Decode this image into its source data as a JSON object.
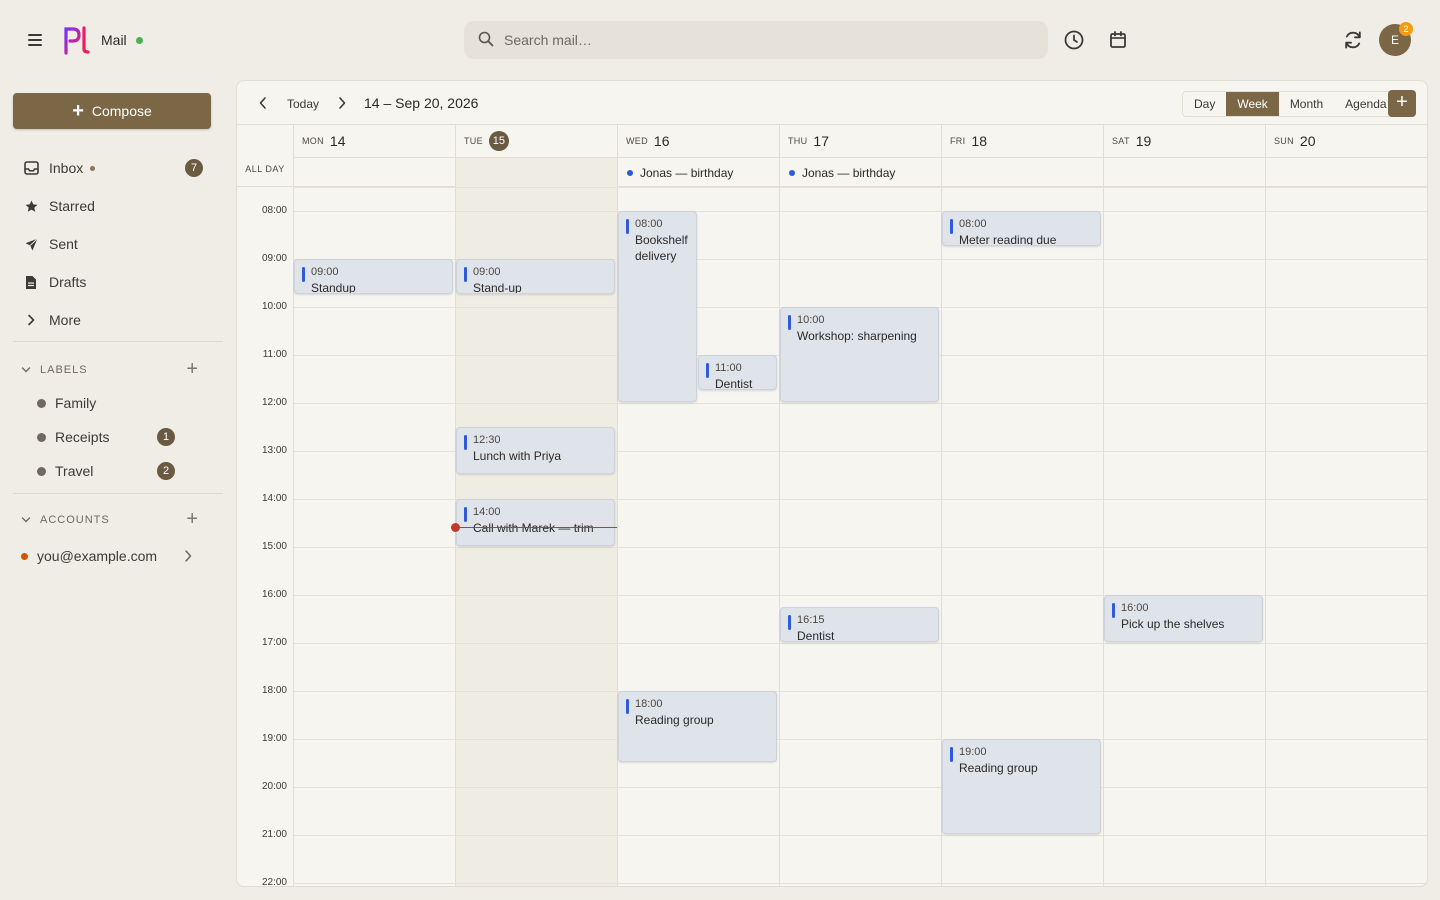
{
  "app": {
    "name": "Mail",
    "search_placeholder": "Search mail…",
    "avatar_initial": "E",
    "avatar_badge": "2"
  },
  "sidebar": {
    "compose_label": "Compose",
    "nav": [
      {
        "label": "Inbox",
        "count": "7",
        "icon": "inbox-icon"
      },
      {
        "label": "Starred",
        "icon": "star-icon"
      },
      {
        "label": "Sent",
        "icon": "send-icon"
      },
      {
        "label": "Drafts",
        "icon": "draft-icon"
      },
      {
        "label": "More",
        "icon": "chevron-right-icon"
      }
    ],
    "labels_title": "LABELS",
    "labels": [
      {
        "name": "Family"
      },
      {
        "name": "Receipts",
        "count": "1"
      },
      {
        "name": "Travel",
        "count": "2"
      }
    ],
    "accounts_title": "ACCOUNTS",
    "account_email": "you@example.com"
  },
  "calendar": {
    "today_label": "Today",
    "range_label": "14 – Sep 20, 2026",
    "views": [
      "Day",
      "Week",
      "Month",
      "Agenda"
    ],
    "active_view": "Week",
    "add_label": "+",
    "allday_label": "ALL DAY",
    "days": [
      {
        "dow": "MON",
        "num": "14"
      },
      {
        "dow": "TUE",
        "num": "15",
        "today": true
      },
      {
        "dow": "WED",
        "num": "16"
      },
      {
        "dow": "THU",
        "num": "17"
      },
      {
        "dow": "FRI",
        "num": "18"
      },
      {
        "dow": "SAT",
        "num": "19"
      },
      {
        "dow": "SUN",
        "num": "20"
      }
    ],
    "hours": [
      "08:00",
      "09:00",
      "10:00",
      "11:00",
      "12:00",
      "13:00",
      "14:00",
      "15:00",
      "16:00",
      "17:00",
      "18:00",
      "19:00",
      "20:00",
      "21:00",
      "22:00"
    ],
    "allday_events": [
      {
        "day": 2,
        "title": "Jonas — birthday"
      },
      {
        "day": 3,
        "title": "Jonas — birthday"
      }
    ],
    "events": [
      {
        "day": 0,
        "start": "09:00",
        "end": "09:45",
        "time": "09:00",
        "title": "Standup"
      },
      {
        "day": 1,
        "start": "09:00",
        "end": "09:45",
        "time": "09:00",
        "title": "Stand-up"
      },
      {
        "day": 1,
        "start": "12:30",
        "end": "13:30",
        "time": "12:30",
        "title": "Lunch with Priya"
      },
      {
        "day": 1,
        "start": "14:00",
        "end": "15:00",
        "time": "14:00",
        "title": "Call with Marek — trim"
      },
      {
        "day": 2,
        "start": "08:00",
        "end": "12:00",
        "time": "08:00",
        "title": "Bookshelf delivery",
        "lane": 0,
        "lanes": 2
      },
      {
        "day": 2,
        "start": "11:00",
        "end": "11:45",
        "time": "11:00",
        "title": "Dentist",
        "lane": 1,
        "lanes": 2
      },
      {
        "day": 2,
        "start": "18:00",
        "end": "19:30",
        "time": "18:00",
        "title": "Reading group"
      },
      {
        "day": 3,
        "start": "10:00",
        "end": "12:00",
        "time": "10:00",
        "title": "Workshop: sharpening"
      },
      {
        "day": 3,
        "start": "16:15",
        "end": "17:00",
        "time": "16:15",
        "title": "Dentist"
      },
      {
        "day": 4,
        "start": "08:00",
        "end": "08:45",
        "time": "08:00",
        "title": "Meter reading due"
      },
      {
        "day": 4,
        "start": "19:00",
        "end": "21:00",
        "time": "19:00",
        "title": "Reading group"
      },
      {
        "day": 5,
        "start": "16:00",
        "end": "17:00",
        "time": "16:00",
        "title": "Pick up the shelves"
      }
    ],
    "now": {
      "day": 1,
      "time": "14:35"
    }
  },
  "colors": {
    "accent": "#7b6646",
    "event_stripe": "#2f5bdb",
    "event_bg": "#dfe3ea",
    "now_line": "#c0392b"
  }
}
